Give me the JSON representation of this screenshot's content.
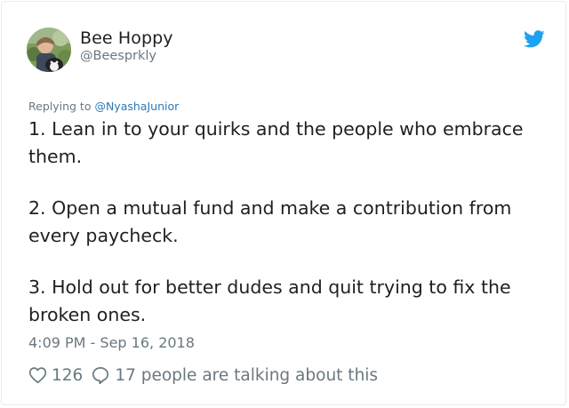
{
  "tweet": {
    "author_name": "Bee Hoppy",
    "author_handle": "@Beesprkly",
    "replying_prefix": "Replying to ",
    "replying_to": "@NyashaJunior",
    "paragraphs": [
      "1. Lean in to your quirks and the people who embrace them.",
      "2. Open a mutual fund and make a contribution from every paycheck.",
      "3. Hold out for better dudes and quit trying to fix the broken ones."
    ],
    "timestamp": "4:09 PM - Sep 16, 2018",
    "like_count": "126",
    "talking_text": "17 people are talking about this"
  },
  "icons": {
    "brand": "twitter-bird-icon",
    "like": "heart-outline-icon",
    "reply": "speech-bubble-icon"
  },
  "colors": {
    "brand_blue": "#1da1f2",
    "link_blue": "#2b7bb9",
    "muted_gray": "#697882",
    "text_dark": "#1c2022",
    "border": "#e6ecf0"
  }
}
